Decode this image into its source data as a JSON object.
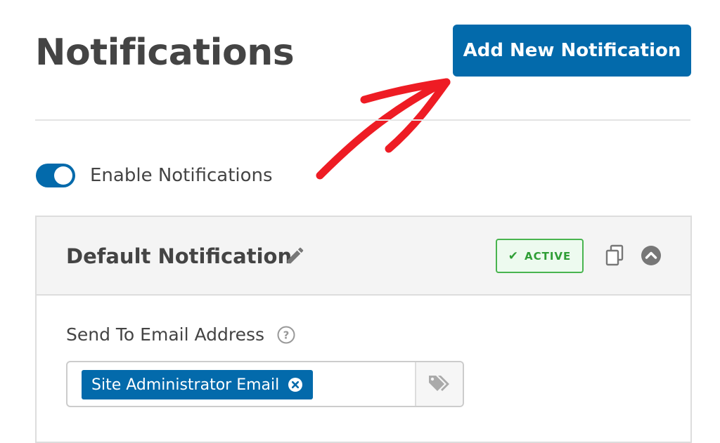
{
  "page": {
    "title": "Notifications",
    "add_button_label": "Add New Notification"
  },
  "toggle": {
    "label": "Enable Notifications",
    "enabled": true
  },
  "notification": {
    "title": "Default Notification",
    "status": "ACTIVE",
    "send_to_label": "Send To Email Address",
    "recipients": [
      "Site Administrator Email"
    ]
  },
  "icons": {
    "edit": "pencil-icon",
    "status": "checkmark-icon",
    "duplicate": "copy-icon",
    "collapse": "chevron-up-circle-icon",
    "help": "question-mark-circle-icon",
    "remove_chip": "close-circle-icon",
    "smart_tags": "tags-icon",
    "annotation": "red-arrow-icon"
  },
  "colors": {
    "primary": "#036aab",
    "active_green": "#49b44f",
    "annotation_red": "#ee1c24",
    "text": "#444444"
  }
}
